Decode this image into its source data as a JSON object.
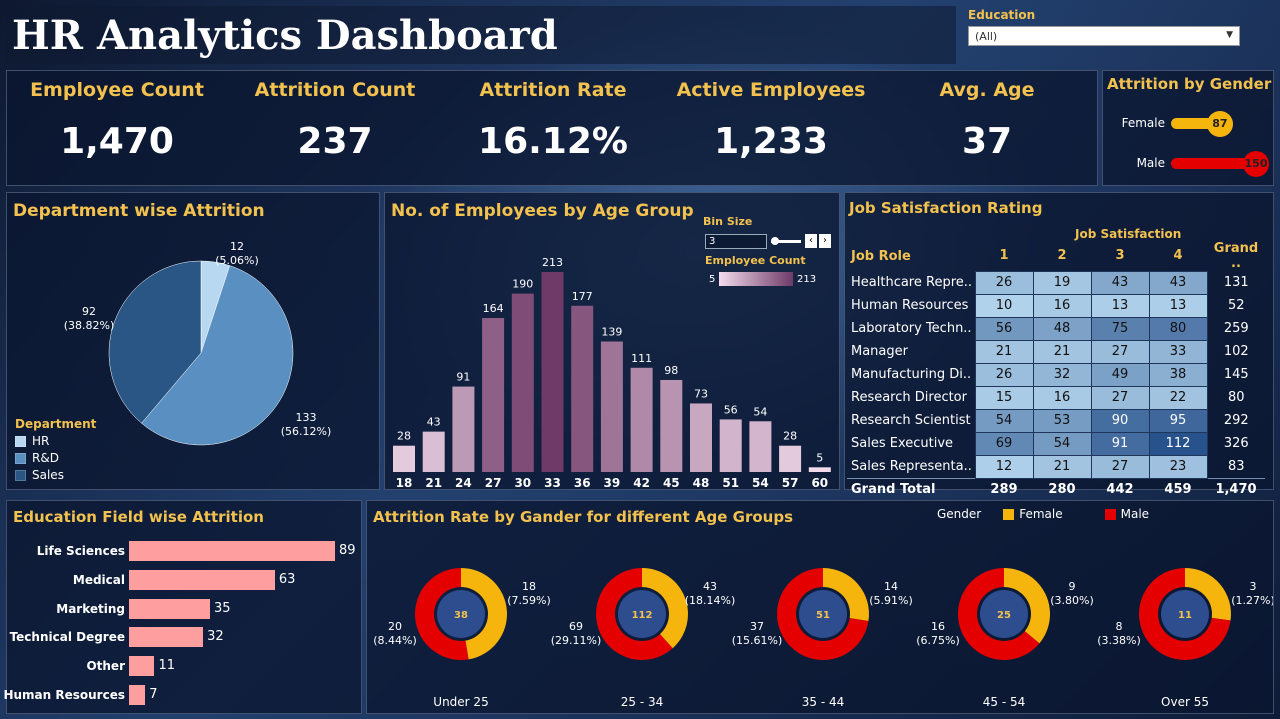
{
  "header": {
    "title": "HR Analytics Dashboard"
  },
  "filter": {
    "label": "Education",
    "value": "(All)"
  },
  "kpis": [
    {
      "label": "Employee Count",
      "value": "1,470"
    },
    {
      "label": "Attrition Count",
      "value": "237"
    },
    {
      "label": "Attrition Rate",
      "value": "16.12%"
    },
    {
      "label": "Active Employees",
      "value": "1,233"
    },
    {
      "label": "Avg. Age",
      "value": "37"
    }
  ],
  "gender": {
    "title": "Attrition by Gender",
    "rows": [
      {
        "label": "Female",
        "value": "87",
        "color": "#f5b50d"
      },
      {
        "label": "Male",
        "value": "150",
        "color": "#e50000"
      }
    ]
  },
  "department": {
    "title": "Department wise Attrition",
    "legend_title": "Department",
    "chart_data": {
      "type": "pie",
      "slices": [
        {
          "name": "HR",
          "value": 12,
          "pct": "(5.06%)",
          "color": "#b8d8f2"
        },
        {
          "name": "R&D",
          "value": 133,
          "pct": "(56.12%)",
          "color": "#5a8fc2"
        },
        {
          "name": "Sales",
          "value": 92,
          "pct": "(38.82%)",
          "color": "#2a5686"
        }
      ]
    }
  },
  "age_group": {
    "title": "No. of Employees by Age Group",
    "bin_label": "Bin Size",
    "bin_value": "3",
    "legend_label": "Employee Count",
    "legend_min": "5",
    "legend_max": "213",
    "chart_data": {
      "type": "bar",
      "categories": [
        "18",
        "21",
        "24",
        "27",
        "30",
        "33",
        "36",
        "39",
        "42",
        "45",
        "48",
        "51",
        "54",
        "57",
        "60"
      ],
      "values": [
        28,
        43,
        91,
        164,
        190,
        213,
        177,
        139,
        111,
        98,
        73,
        56,
        54,
        28,
        5
      ]
    }
  },
  "job_satisfaction": {
    "title": "Job Satisfaction Rating",
    "col_header": "Job Satisfaction",
    "role_header": "Job Role",
    "columns": [
      "1",
      "2",
      "3",
      "4"
    ],
    "total_header": "Grand ..",
    "rows": [
      {
        "role": "Healthcare Repre..",
        "values": [
          "26",
          "19",
          "43",
          "43"
        ],
        "total": "131"
      },
      {
        "role": "Human Resources",
        "values": [
          "10",
          "16",
          "13",
          "13"
        ],
        "total": "52"
      },
      {
        "role": "Laboratory Techn..",
        "values": [
          "56",
          "48",
          "75",
          "80"
        ],
        "total": "259"
      },
      {
        "role": "Manager",
        "values": [
          "21",
          "21",
          "27",
          "33"
        ],
        "total": "102"
      },
      {
        "role": "Manufacturing Di..",
        "values": [
          "26",
          "32",
          "49",
          "38"
        ],
        "total": "145"
      },
      {
        "role": "Research Director",
        "values": [
          "15",
          "16",
          "27",
          "22"
        ],
        "total": "80"
      },
      {
        "role": "Research Scientist",
        "values": [
          "54",
          "53",
          "90",
          "95"
        ],
        "total": "292"
      },
      {
        "role": "Sales Executive",
        "values": [
          "69",
          "54",
          "91",
          "112"
        ],
        "total": "326"
      },
      {
        "role": "Sales Representa..",
        "values": [
          "12",
          "21",
          "27",
          "23"
        ],
        "total": "83"
      }
    ],
    "grand_total": {
      "label": "Grand Total",
      "values": [
        "289",
        "280",
        "442",
        "459"
      ],
      "total": "1,470"
    }
  },
  "education_field": {
    "title": "Education Field wise Attrition",
    "chart_data": {
      "type": "bar",
      "categories": [
        "Life Sciences",
        "Medical",
        "Marketing",
        "Technical Degree",
        "Other",
        "Human Resources"
      ],
      "values": [
        89,
        63,
        35,
        32,
        11,
        7
      ]
    }
  },
  "age_gender": {
    "title": "Attrition Rate by Gander for different Age Groups",
    "legend_title": "Gender",
    "legend": [
      {
        "name": "Female",
        "color": "#f5b50d"
      },
      {
        "name": "Male",
        "color": "#e50000"
      }
    ],
    "chart_data": {
      "type": "pie",
      "groups": [
        {
          "name": "Under 25",
          "total": "38",
          "female": 18,
          "female_pct": "(7.59%)",
          "male": 20,
          "male_pct": "(8.44%)"
        },
        {
          "name": "25 - 34",
          "total": "112",
          "female": 43,
          "female_pct": "(18.14%)",
          "male": 69,
          "male_pct": "(29.11%)"
        },
        {
          "name": "35 - 44",
          "total": "51",
          "female": 14,
          "female_pct": "(5.91%)",
          "male": 37,
          "male_pct": "(15.61%)"
        },
        {
          "name": "45 - 54",
          "total": "25",
          "female": 9,
          "female_pct": "(3.80%)",
          "male": 16,
          "male_pct": "(6.75%)"
        },
        {
          "name": "Over 55",
          "total": "11",
          "female": 3,
          "female_pct": "(1.27%)",
          "male": 8,
          "male_pct": "(3.38%)"
        }
      ]
    }
  }
}
